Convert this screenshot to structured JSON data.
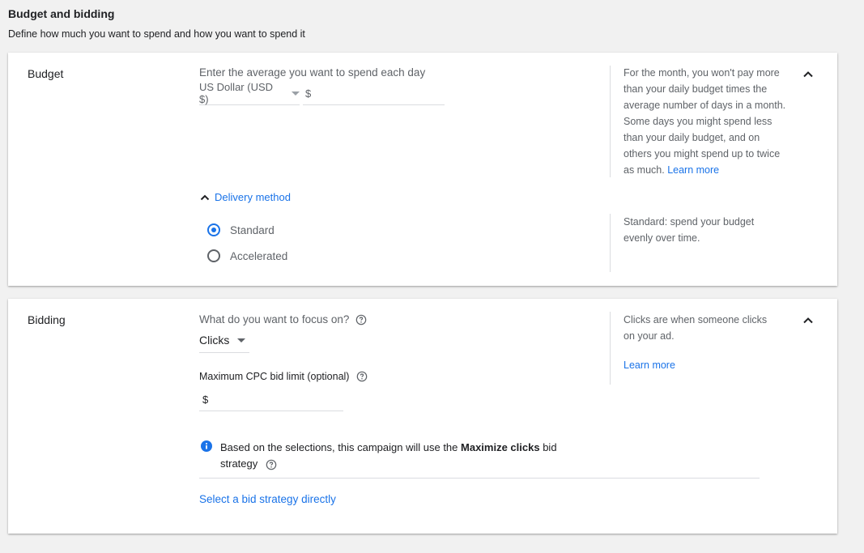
{
  "page": {
    "title": "Budget and bidding",
    "subtitle": "Define how much you want to spend and how you want to spend it"
  },
  "budget": {
    "title": "Budget",
    "prompt": "Enter the average you want to spend each day",
    "currency_label": "US Dollar (USD $)",
    "currency_prefix": "$",
    "amount_value": "",
    "side_text": "For the month, you won't pay more than your daily budget times the average number of days in a month. Some days you might spend less than your daily budget, and on others you might spend up to twice as much.",
    "side_link": "Learn more",
    "delivery": {
      "toggle_label": "Delivery method",
      "options": [
        {
          "label": "Standard",
          "checked": true
        },
        {
          "label": "Accelerated",
          "checked": false
        }
      ],
      "side_text": "Standard: spend your budget evenly over time."
    }
  },
  "bidding": {
    "title": "Bidding",
    "focus_prompt": "What do you want to focus on?",
    "focus_value": "Clicks",
    "max_cpc_label": "Maximum CPC bid limit (optional)",
    "max_cpc_prefix": "$",
    "max_cpc_value": "",
    "side_text": "Clicks are when someone clicks on your ad.",
    "side_link": "Learn more",
    "info_prefix": "Based on the selections, this campaign will use the",
    "info_strategy": "Maximize clicks",
    "info_suffix1": "bid",
    "info_suffix2": "strategy",
    "select_strategy_link": "Select a bid strategy directly"
  },
  "colors": {
    "accent": "#1a73e8",
    "muted_text": "#5f6368",
    "divider": "#dadce0"
  },
  "icons": {
    "collapse": "chevron-up-icon",
    "help": "help-circle-icon",
    "info": "info-icon",
    "dropdown": "caret-down-icon"
  }
}
